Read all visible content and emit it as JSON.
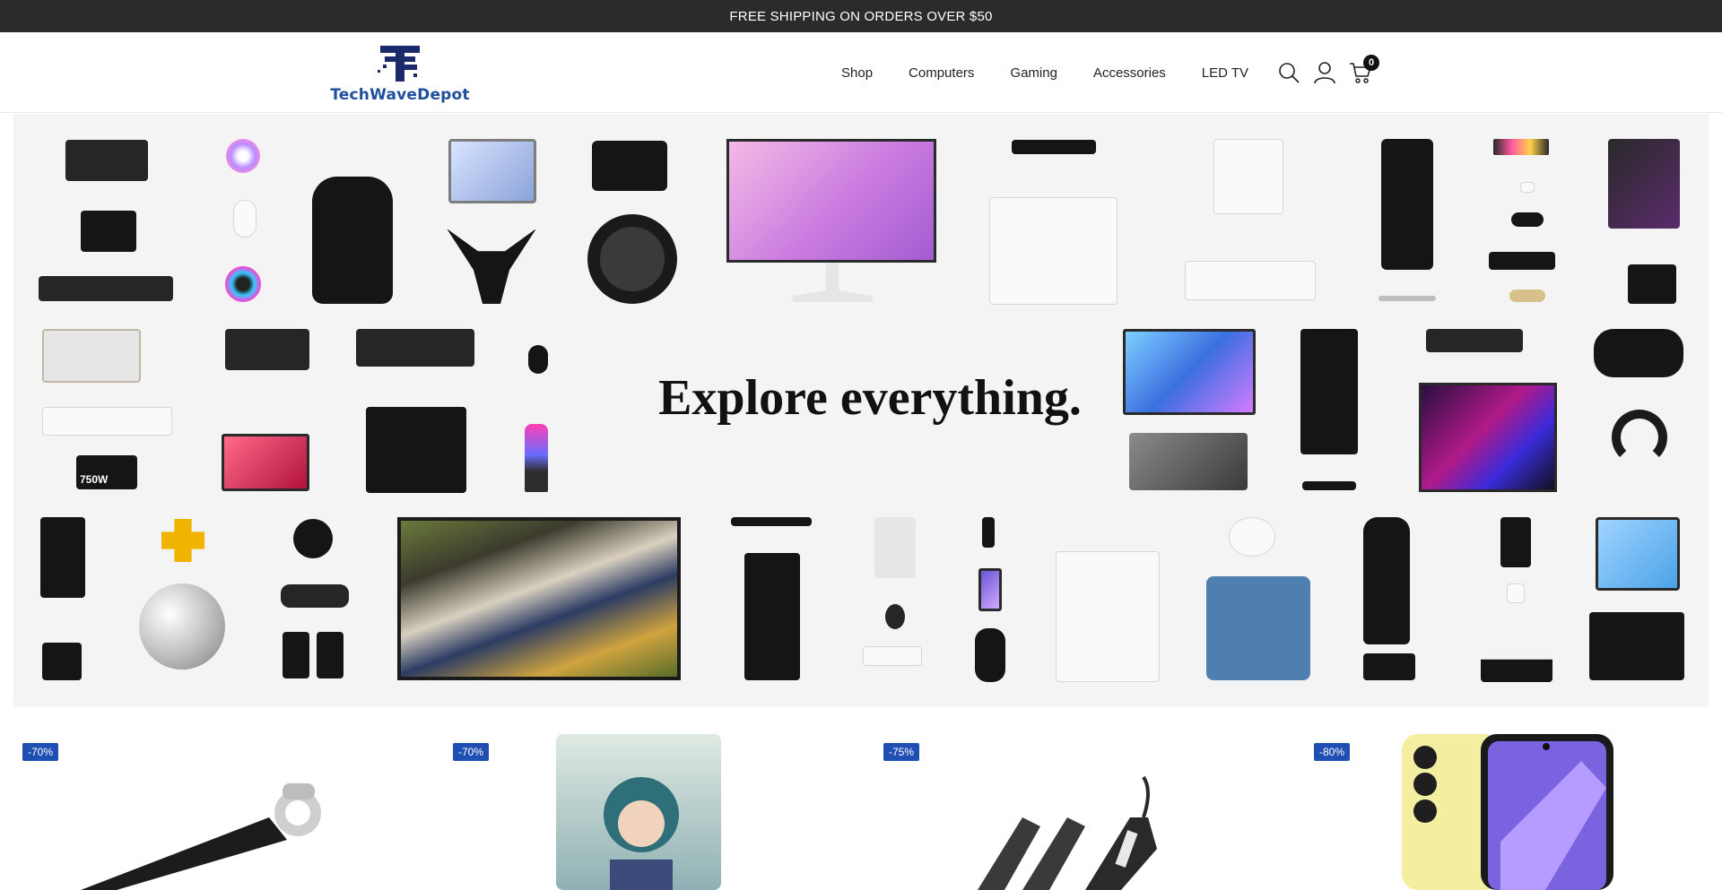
{
  "announcement": {
    "text": "FREE SHIPPING ON ORDERS OVER $50"
  },
  "header": {
    "logo_text": "TechWaveDepot",
    "nav": [
      {
        "label": "Shop"
      },
      {
        "label": "Computers"
      },
      {
        "label": "Gaming"
      },
      {
        "label": "Accessories"
      },
      {
        "label": "LED TV"
      }
    ],
    "icons": [
      "search-icon",
      "account-icon",
      "cart-icon"
    ],
    "cart_count": "0"
  },
  "hero": {
    "title": "Explore everything.",
    "product_label_psu": "750W"
  },
  "products": [
    {
      "discount": "-70%"
    },
    {
      "discount": "-70%"
    },
    {
      "discount": "-75%"
    },
    {
      "discount": "-80%"
    }
  ],
  "colors": {
    "announcement_bg": "#2b2b2b",
    "badge_bg": "#1f4fb3",
    "logo_blue": "#1f4e9c",
    "logo_navy": "#1b2a6b",
    "hero_bg": "#f4f4f4"
  }
}
